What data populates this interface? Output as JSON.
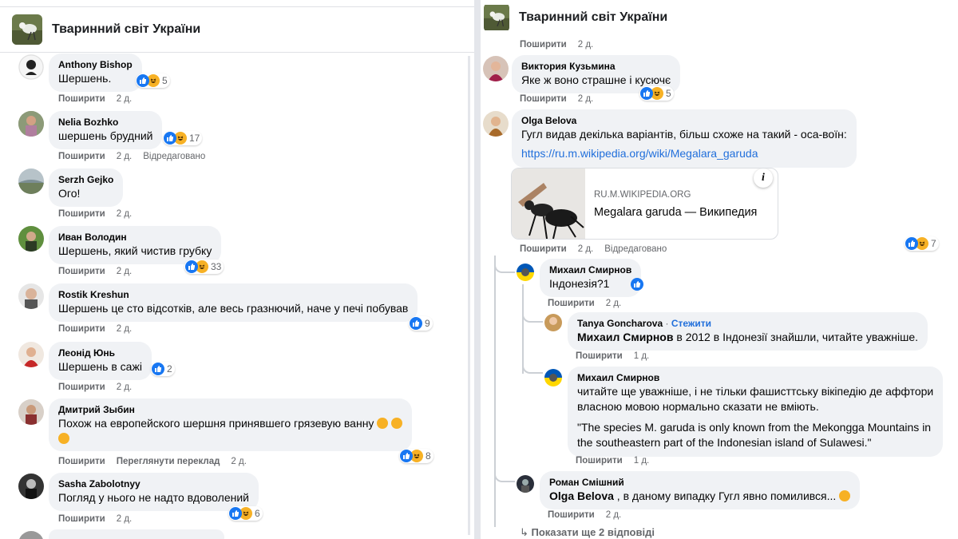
{
  "page_name": "Тваринний світ України",
  "labels": {
    "share": "Поширити",
    "time2": "2 д.",
    "time1": "1 д.",
    "edited": "Відредаговано",
    "see_translation": "Переглянути переклад",
    "follow": "Стежити"
  },
  "left": {
    "comments": [
      {
        "name": "Anthony Bishop",
        "text": "Шершень.",
        "count": "5"
      },
      {
        "name": "Nelia Bozhko",
        "text": "шершень брудний",
        "count": "17"
      },
      {
        "name": "Serzh Gejko",
        "text": "Ого!"
      },
      {
        "name": "Иван Володин",
        "text": "Шершень, який чистив грубку",
        "count": "33"
      },
      {
        "name": "Rostik Kreshun",
        "text": "Шершень це сто відсотків, але весь гразнючий, наче у печі побував",
        "count": "9"
      },
      {
        "name": "Леонід Юнь",
        "text": "Шершень в сажі",
        "count": "2"
      },
      {
        "name": "Дмитрий Зыбин",
        "text": "Похож на европейского шершня принявшего грязевую ванну",
        "count": "8"
      },
      {
        "name": "Sasha Zabolotnyy",
        "text": "Погляд у нього не надто вдоволений",
        "count": "6"
      }
    ]
  },
  "right": {
    "viktoria": {
      "name": "Виктория Кузьмина",
      "text": "Яке ж воно страшне і кусючє",
      "count": "5"
    },
    "olga": {
      "name": "Olga Belova",
      "text": "Гугл видав декілька варіантів, більш схоже на такий - оса-воїн:",
      "link": "https://ru.m.wikipedia.org/wiki/Megalara_garuda",
      "preview_domain": "RU.M.WIKIPEDIA.ORG",
      "preview_title": "Megalara garuda — Википедия",
      "count": "7"
    },
    "mikhail1": {
      "name": "Михаил Смирнов",
      "text": "Індонезія?1"
    },
    "tanya": {
      "name": "Tanya Goncharova",
      "mention": "Михаил Смирнов",
      "text": " в 2012 в Індонезії знайшли, читайте уважніше."
    },
    "mikhail2": {
      "name": "Михаил Смирнов",
      "text1": "читайте ще уважніше, і не тільки фашисттську вікіпедію де аффтори",
      "text2": "власною мовою нормально сказати не вміють.",
      "quote1": "\"The species M. garuda is only known from the Mekongga Mountains in",
      "quote2": "the southeastern part of the Indonesian island of Sulawesi.\""
    },
    "roman": {
      "name": "Роман Смішний",
      "mention": "Olga Belova",
      "text": " , в даному випадку Гугл явно помилився..."
    },
    "more_replies": "Показати ще 2 відповіді"
  }
}
